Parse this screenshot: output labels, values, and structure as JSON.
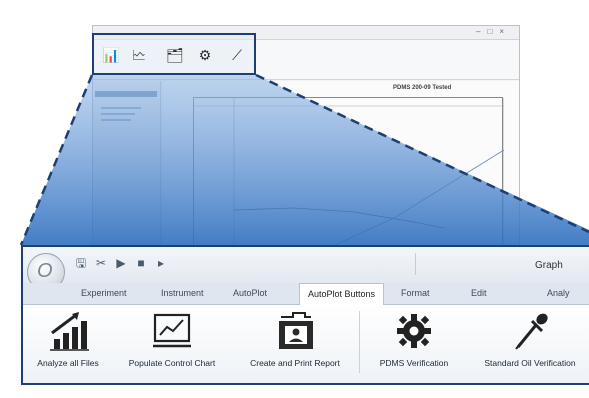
{
  "background_window": {
    "plot_title": "PDMS 200-09 Tested"
  },
  "quick_access": {
    "window_title": "Graph"
  },
  "tabs": [
    {
      "label": "Experiment",
      "active": false
    },
    {
      "label": "Instrument",
      "active": false
    },
    {
      "label": "AutoPlot",
      "active": false
    },
    {
      "label": "AutoPlot Buttons",
      "active": true
    },
    {
      "label": "Format",
      "active": false
    },
    {
      "label": "Edit",
      "active": false
    },
    {
      "label": "Analy",
      "active": false
    }
  ],
  "ribbon_buttons": [
    {
      "label": "Analyze all Files",
      "icon": "bar-chart-icon"
    },
    {
      "label": "Populate Control Chart",
      "icon": "line-chart-icon"
    },
    {
      "label": "Create and Print Report",
      "icon": "folder-report-icon"
    },
    {
      "label": "PDMS Verification",
      "icon": "gear-icon"
    },
    {
      "label": "Standard Oil Verification",
      "icon": "dropper-icon"
    }
  ],
  "colors": {
    "accent": "#1e3f73",
    "wedge_blue": "#3a78c4"
  }
}
